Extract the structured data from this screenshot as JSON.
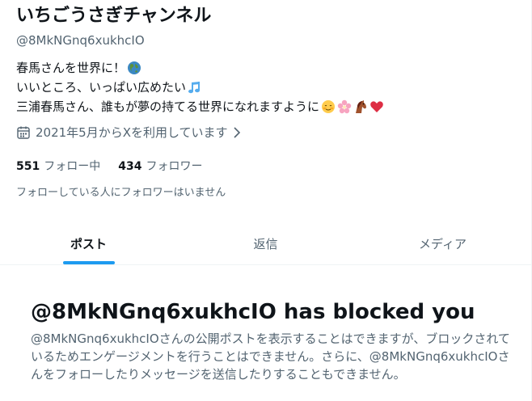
{
  "profile": {
    "display_name": "いちごうさぎチャンネル",
    "handle": "@8MkNGnq6xukhcIO",
    "bio": {
      "line1": "春馬さんを世界に！",
      "line2": "いいところ、いっぱい広めたい",
      "line3": "三浦春馬さん、誰もが夢の持てる世界になれますように"
    },
    "joined": "2021年5月からXを利用しています",
    "following": {
      "count": "551",
      "label": "フォロー中"
    },
    "followers": {
      "count": "434",
      "label": "フォロワー"
    },
    "no_followers_you_know": "フォローしている人にフォロワーはいません"
  },
  "tabs": [
    {
      "label": "ポスト",
      "active": true
    },
    {
      "label": "返信",
      "active": false
    },
    {
      "label": "メディア",
      "active": false
    }
  ],
  "blocked": {
    "title": "@8MkNGnq6xukhcIO has blocked you",
    "description": "@8MkNGnq6xukhcIOさんの公開ポストを表示することはできますが、ブロックされているためエンゲージメントを行うことはできません。さらに、@8MkNGnq6xukhcIOさんをフォローしたりメッセージを送信したりすることもできません。"
  },
  "icons": [
    "globe-icon",
    "music-note-icon",
    "smiling-face-icon",
    "cherry-blossom-icon",
    "horse-icon",
    "red-heart-icon",
    "calendar-icon",
    "chevron-right-icon"
  ],
  "colors": {
    "accent": "#1d9bf0",
    "text": "#0f1419",
    "secondary_text": "#536471"
  }
}
